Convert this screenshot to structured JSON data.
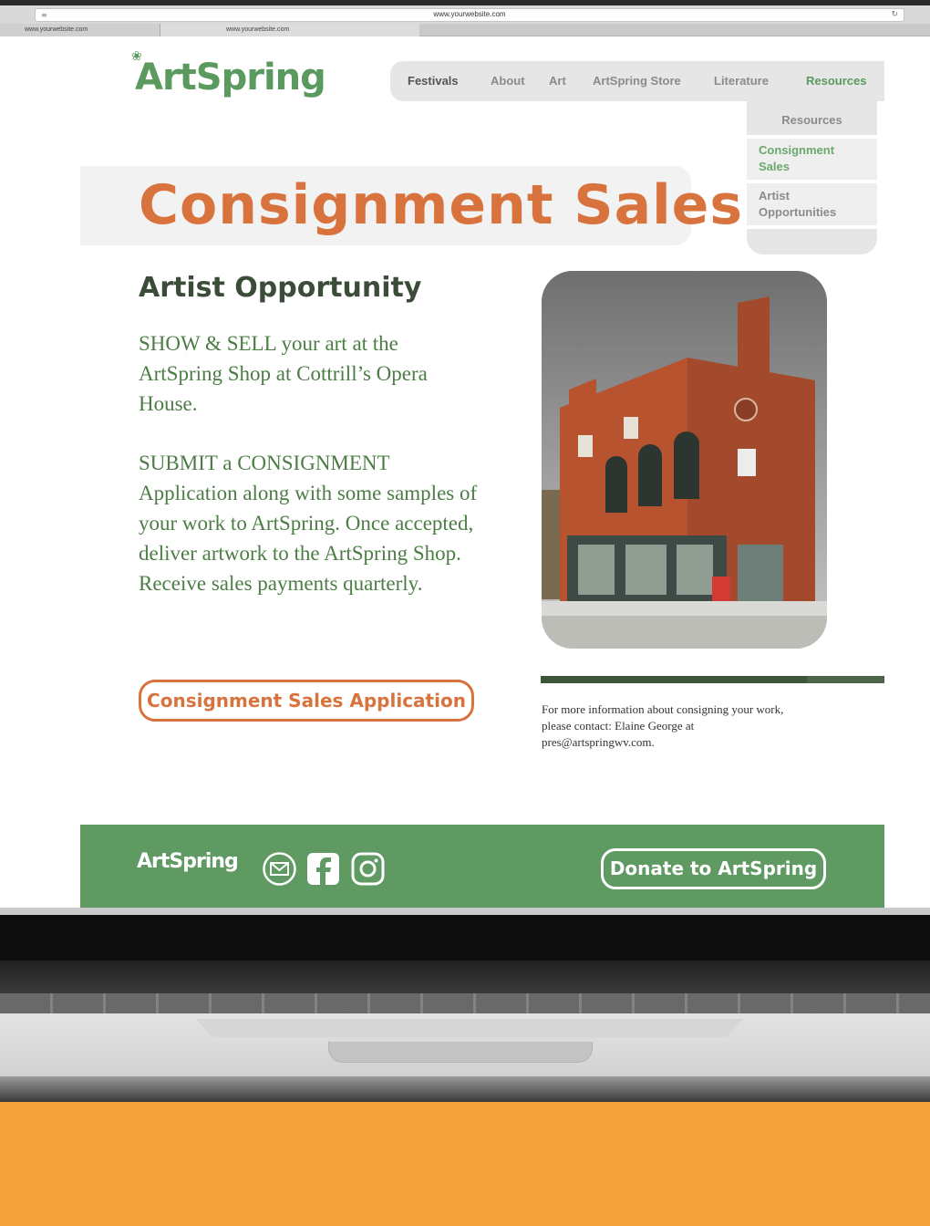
{
  "browser": {
    "url": "www.yourwebsite.com",
    "tabs": [
      {
        "label": "www.yourwebsite.com"
      },
      {
        "label": "www.yourwebsite.com"
      }
    ]
  },
  "header": {
    "logo_text": "ArtSpring",
    "nav": {
      "festivals": "Festivals",
      "about": "About",
      "art": "Art",
      "store": "ArtSpring Store",
      "literature": "Literature",
      "resources": "Resources"
    },
    "dropdown": {
      "resources": "Resources",
      "consignment_line1": "Consignment",
      "consignment_line2": "Sales",
      "artist_line1": "Artist",
      "artist_line2": "Opportunities"
    }
  },
  "main": {
    "title": "Consignment Sales",
    "heading": "Artist Opportunity",
    "paragraph_1": "SHOW & SELL your art at the ArtSpring Shop at Cottrill’s Opera House.",
    "paragraph_2": "SUBMIT a CONSIGNMENT Application along with some samples of your work to ArtSpring. Once accepted, deliver artwork to the ArtSpring Shop.",
    "paragraph_3": "Receive sales payments quarterly.",
    "apply_button": "Consignment Sales Application",
    "contact": "For more information about consigning your work, please contact: Elaine George at pres@artspringwv.com."
  },
  "footer": {
    "logo_text": "ArtSpring",
    "donate_button": "Donate to ArtSpring",
    "icons": [
      "mail-icon",
      "facebook-icon",
      "instagram-icon"
    ]
  },
  "colors": {
    "brand_green": "#5f9a63",
    "accent_orange": "#d9733e",
    "text_green": "#4c7d45",
    "dark_green": "#3b4d38",
    "background_orange": "#f4a33c"
  }
}
